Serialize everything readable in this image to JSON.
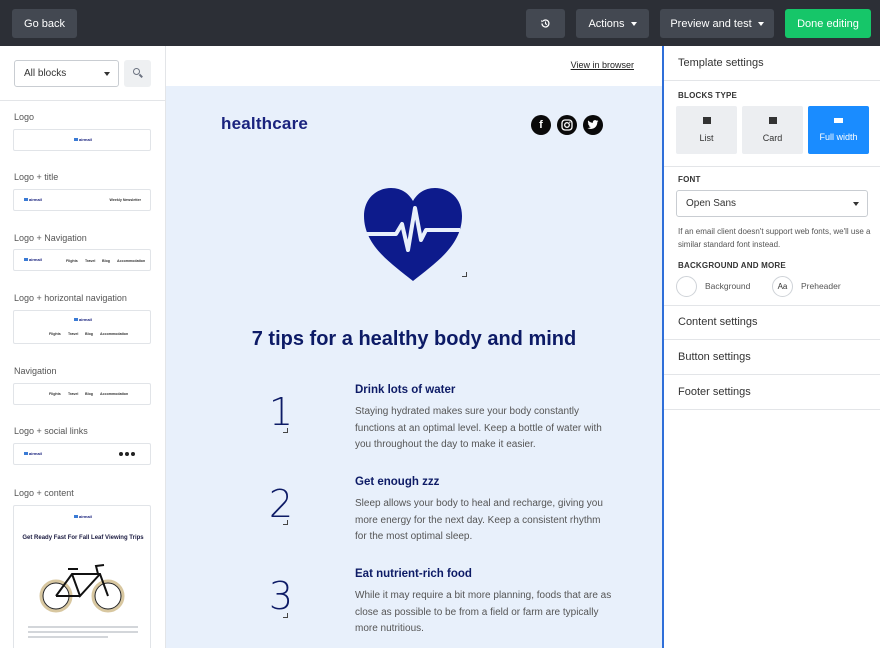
{
  "topbar": {
    "back_label": "Go back",
    "actions_label": "Actions",
    "preview_label": "Preview and test",
    "done_label": "Done editing",
    "icons": {
      "history": "history-icon"
    }
  },
  "sidebar": {
    "filter_value": "All blocks",
    "blocks": [
      {
        "label": "Logo"
      },
      {
        "label": "Logo + title",
        "thumb_title": "Weekly Newsletter"
      },
      {
        "label": "Logo + Navigation"
      },
      {
        "label": "Logo + horizontal navigation"
      },
      {
        "label": "Navigation"
      },
      {
        "label": "Logo + social links"
      },
      {
        "label": "Logo + content",
        "thumb_title": "Get Ready Fast For Fall Leaf Viewing Trips"
      }
    ],
    "mini_brand": "airmail",
    "mini_nav": [
      "Flights",
      "Travel",
      "Blog",
      "Accommodation"
    ]
  },
  "canvas": {
    "view_in_browser": "View in browser",
    "brand": "healthcare",
    "headline": "7 tips for a healthy body and mind",
    "tips": [
      {
        "number": "1",
        "title": "Drink lots of water",
        "body": "Staying hydrated makes sure your body constantly functions at an optimal level. Keep a bottle of water with you throughout the day to make it easier."
      },
      {
        "number": "2",
        "title": "Get enough zzz",
        "body": "Sleep allows your body to heal and recharge, giving you more energy for the next day. Keep a consistent rhythm for the most optimal sleep."
      },
      {
        "number": "3",
        "title": "Eat nutrient-rich food",
        "body": "While it may require a bit more planning, foods that are as close as possible to be from a field or farm are typically more nutritious."
      }
    ],
    "colors": {
      "background": "#e8f0fb",
      "heading": "#0d1b66"
    }
  },
  "panel": {
    "template_settings": "Template settings",
    "blocks_type_heading": "BLOCKS TYPE",
    "block_types": [
      "List",
      "Card",
      "Full width"
    ],
    "active_block_type": "Full width",
    "font_heading": "FONT",
    "font_value": "Open Sans",
    "font_note": "If an email client doesn't support web fonts, we'll use a similar standard font instead.",
    "background_heading": "BACKGROUND AND MORE",
    "background_label": "Background",
    "preheader_label": "Preheader",
    "preheader_glyph": "Aa",
    "content_settings": "Content settings",
    "button_settings": "Button settings",
    "footer_settings": "Footer settings",
    "accent_color": "#1a8cff"
  }
}
